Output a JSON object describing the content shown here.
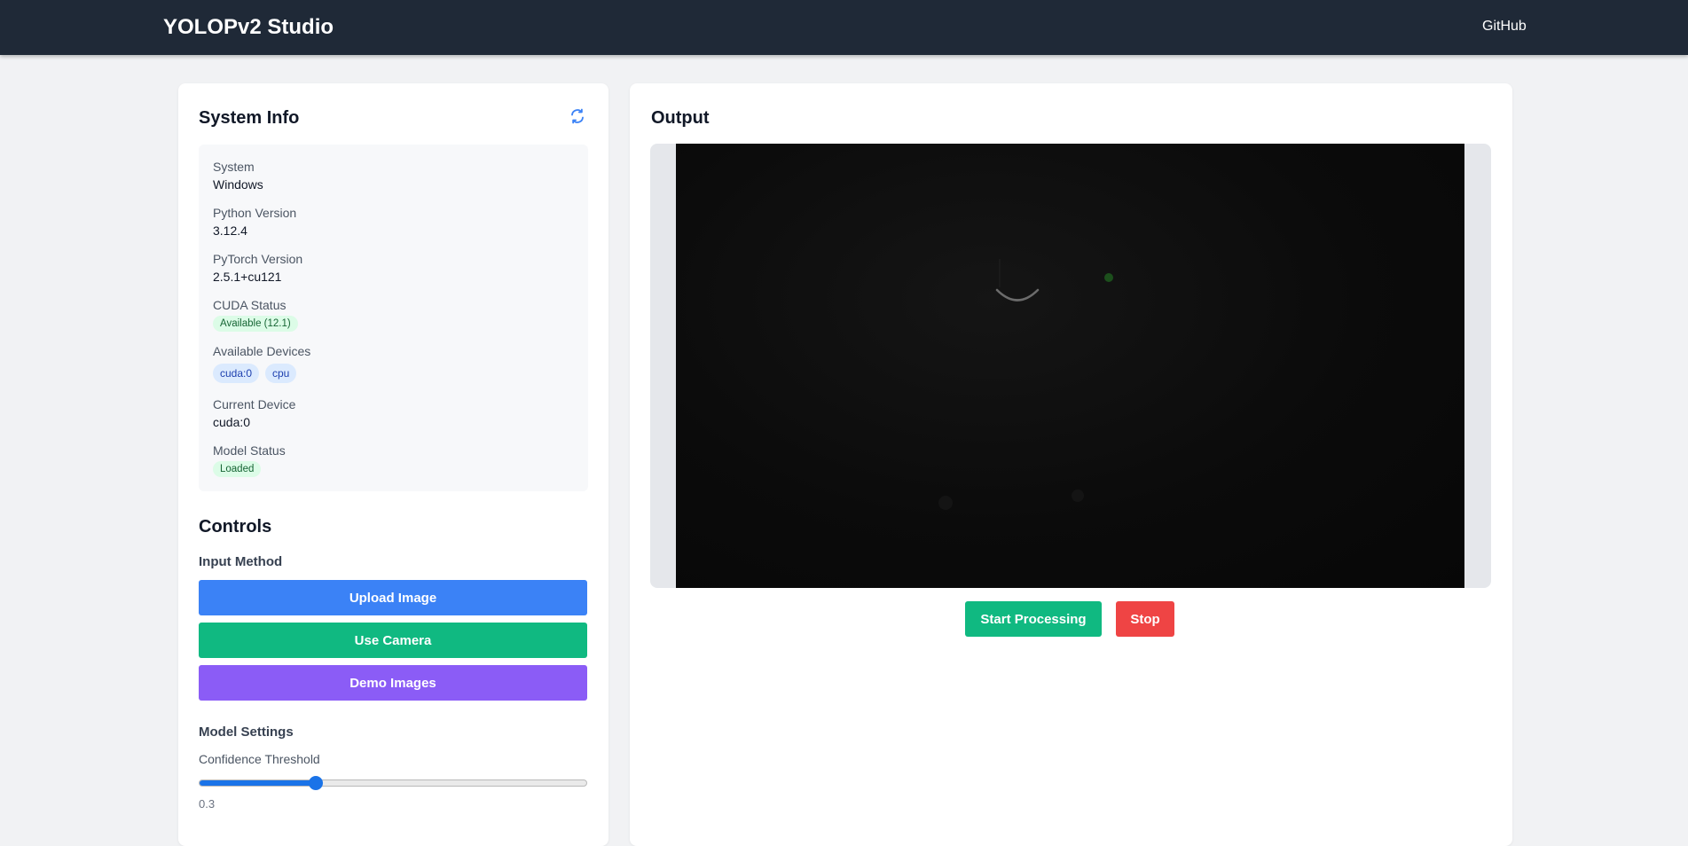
{
  "header": {
    "brand": "YOLOPv2 Studio",
    "github_label": "GitHub"
  },
  "system_info": {
    "title": "System Info",
    "refresh_icon": "refresh-icon",
    "items": {
      "system": {
        "label": "System",
        "value": "Windows"
      },
      "python": {
        "label": "Python Version",
        "value": "3.12.4"
      },
      "pytorch": {
        "label": "PyTorch Version",
        "value": "2.5.1+cu121"
      },
      "cuda": {
        "label": "CUDA Status",
        "value": "Available (12.1)"
      },
      "devices": {
        "label": "Available Devices",
        "values": [
          "cuda:0",
          "cpu"
        ]
      },
      "current_device": {
        "label": "Current Device",
        "value": "cuda:0"
      },
      "model_status": {
        "label": "Model Status",
        "value": "Loaded"
      }
    }
  },
  "controls": {
    "title": "Controls",
    "input_method_label": "Input Method",
    "buttons": {
      "upload": "Upload Image",
      "camera": "Use Camera",
      "demo": "Demo Images"
    },
    "model_settings_label": "Model Settings",
    "confidence": {
      "label": "Confidence Threshold",
      "value": "0.3",
      "fraction": 0.3
    }
  },
  "output": {
    "title": "Output",
    "start_label": "Start Processing",
    "stop_label": "Stop"
  },
  "colors": {
    "navbar": "#1f2937",
    "primary_blue": "#3b82f6",
    "success_green": "#10b981",
    "purple": "#8b5cf6",
    "danger_red": "#ef4444",
    "accent": "#1a73e8"
  }
}
